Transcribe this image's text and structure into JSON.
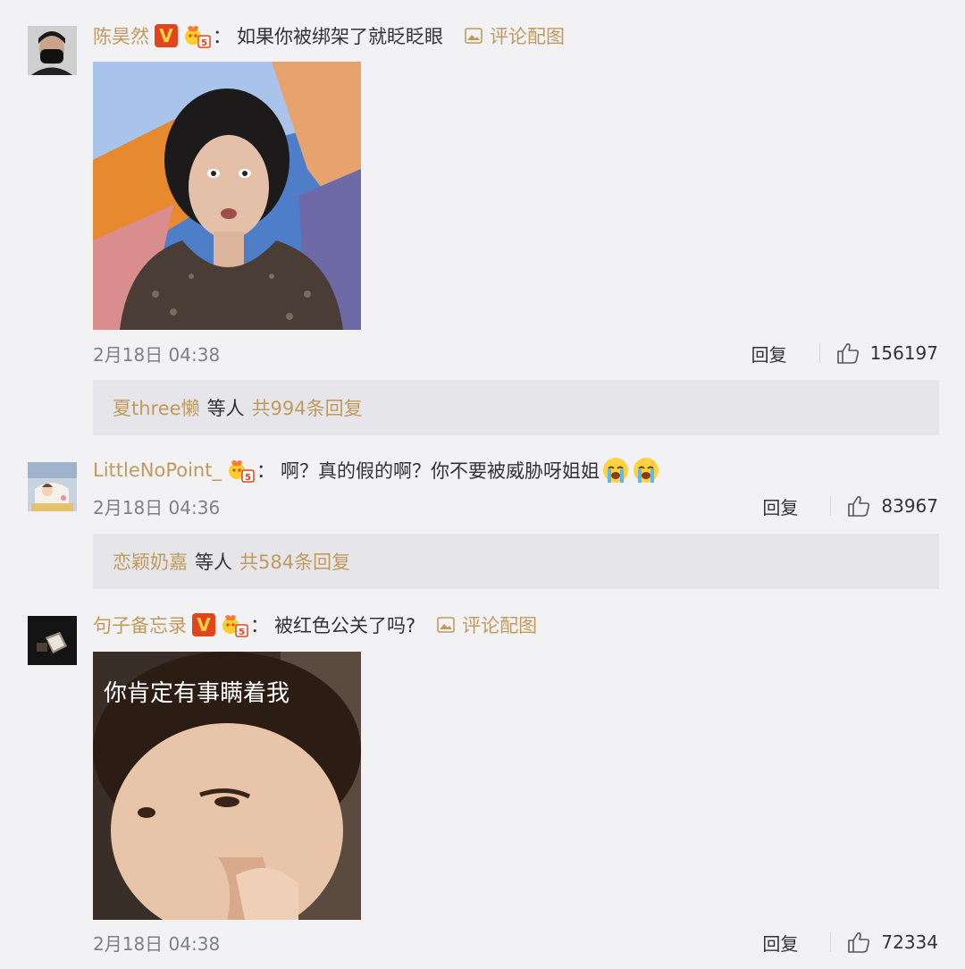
{
  "colors": {
    "background": "#f2f2f5",
    "username": "#c09a5d",
    "reply_box": "#e6e6ea",
    "vip_badge": "#e2441c"
  },
  "comments": [
    {
      "username": "陈昊然",
      "colon": "：",
      "text": "如果你被绑架了就眨眨眼",
      "has_vip": true,
      "vip_label": "V",
      "pic_link": "评论配图",
      "time": "2月18日 04:38",
      "reply_label": "回复",
      "likes": "156197",
      "replies": {
        "users": "夏three懒",
        "and_others": "等人",
        "total": "共994条回复"
      }
    },
    {
      "username": "LittleNoPoint_",
      "colon": "：",
      "text": "啊？真的假的啊？你不要被威胁呀姐姐",
      "emojis": [
        "crying-emoji",
        "crying-emoji"
      ],
      "time": "2月18日 04:36",
      "reply_label": "回复",
      "likes": "83967",
      "replies": {
        "users": "恋颖奶嘉",
        "and_others": "等人",
        "total": "共584条回复"
      }
    },
    {
      "username": "句子备忘录",
      "colon": "：",
      "text": "被红色公关了吗?",
      "has_vip": true,
      "vip_label": "V",
      "pic_link": "评论配图",
      "image_caption": "你肯定有事瞒着我",
      "time": "2月18日 04:38",
      "reply_label": "回复",
      "likes": "72334"
    }
  ]
}
